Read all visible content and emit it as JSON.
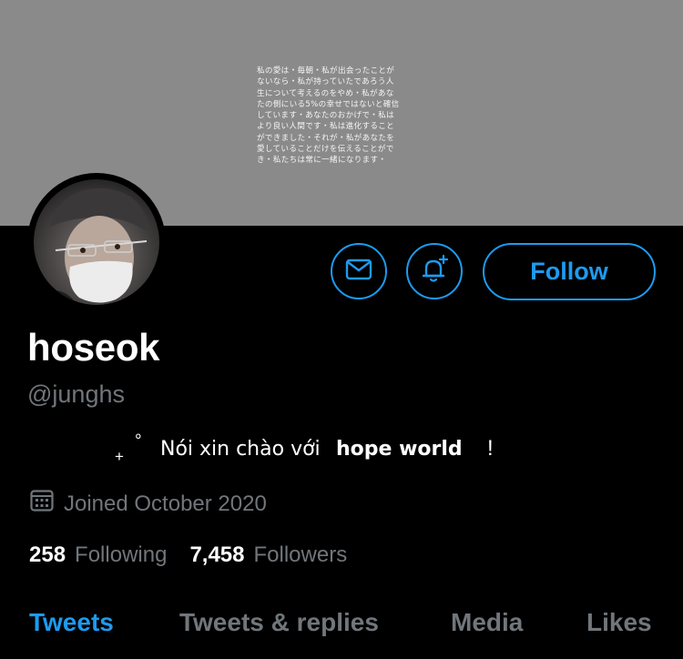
{
  "banner": {
    "text": "私の愛は・毎朝・私が出会ったことが\nないなら・私が持っていたであろう人\n生について考えるのをやめ・私があな\nたの側にいる5%の幸せではないと確信\nしています・あなたのおかげで・私は\nより良い人間です・私は進化すること\nができました・それが・私があなたを\n愛していることだけを伝えることがで\nき・私たちは常に一緒になります・"
  },
  "profile": {
    "name": "hoseok",
    "handle": "@junghs",
    "bio": {
      "plus": "+",
      "degree": "°",
      "text": "Nói xin chào với",
      "bold": "hope world",
      "end": "!"
    },
    "joined": "Joined October 2020",
    "following_count": "258",
    "following_label": "Following",
    "followers_count": "7,458",
    "followers_label": "Followers"
  },
  "actions": {
    "follow_label": "Follow",
    "message_icon": "envelope-icon",
    "notify_icon": "bell-plus-icon"
  },
  "tabs": [
    {
      "label": "Tweets",
      "active": true
    },
    {
      "label": "Tweets & replies",
      "active": false
    },
    {
      "label": "Media",
      "active": false
    },
    {
      "label": "Likes",
      "active": false
    }
  ],
  "colors": {
    "accent": "#1d9bf0",
    "muted": "#71767b",
    "background": "#000000",
    "banner": "#8a8a8a"
  }
}
